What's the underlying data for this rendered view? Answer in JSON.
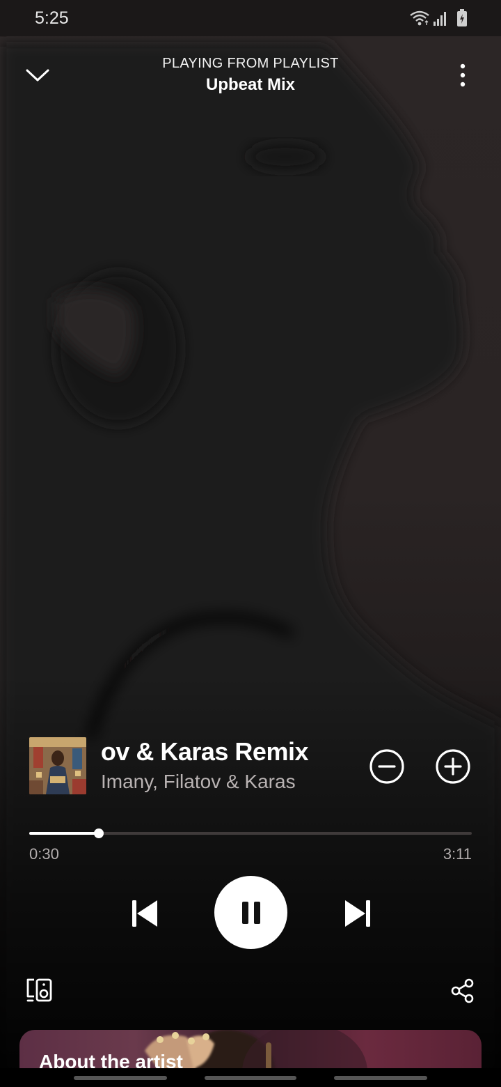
{
  "status_bar": {
    "time": "5:25",
    "icons": [
      "wifi-icon",
      "signal-icon",
      "battery-charging-icon"
    ]
  },
  "header": {
    "context_label": "PLAYING FROM PLAYLIST",
    "playlist_name": "Upbeat Mix",
    "collapse_icon": "chevron-down-icon",
    "menu_icon": "more-vertical-icon"
  },
  "track": {
    "title": "Filatov & Karas Remix",
    "artist": "Imany, Filatov & Karas",
    "remove_icon": "minus-circle-icon",
    "add_icon": "plus-circle-icon"
  },
  "playback": {
    "elapsed": "0:30",
    "total": "3:11",
    "progress_fraction": 0.157,
    "state_icon": "pause-icon"
  },
  "footer": {
    "devices_icon": "connect-device-icon",
    "share_icon": "share-icon"
  },
  "about_card": {
    "title": "About the artist"
  },
  "colors": {
    "background": "#2a2424",
    "text_primary": "#ffffff",
    "text_secondary": "#b3aeae",
    "progress_track": "#3f3a3a",
    "about_card": "#5d2f45"
  }
}
